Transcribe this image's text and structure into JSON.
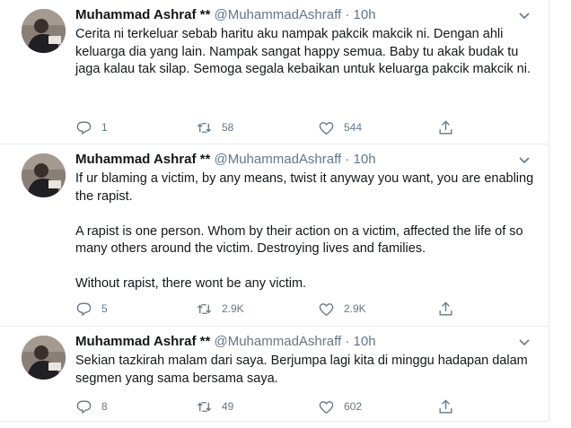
{
  "tweets": [
    {
      "name": "Muhammad Ashraf **",
      "handle": "@MuhammadAshraff",
      "separator": "·",
      "time": "10h",
      "text": "Cerita ni terkeluar sebab haritu aku nampak pakcik makcik ni. Dengan ahli keluarga dia yang lain. Nampak sangat happy semua. Baby tu akak budak tu jaga kalau tak silap. Semoga segala kebaikan untuk keluarga pakcik makcik ni.",
      "replies": "1",
      "retweets": "58",
      "likes": "544"
    },
    {
      "name": "Muhammad Ashraf **",
      "handle": "@MuhammadAshraff",
      "separator": "·",
      "time": "10h",
      "text": "If ur blaming a victim, by any means, twist it anyway you want, you are enabling the rapist.\n\nA rapist is one person. Whom by their action on a victim, affected the life of so many others around the victim. Destroying lives and families.\n\nWithout rapist, there wont be any victim.",
      "replies": "5",
      "retweets": "2.9K",
      "likes": "2.9K"
    },
    {
      "name": "Muhammad Ashraf **",
      "handle": "@MuhammadAshraff",
      "separator": "·",
      "time": "10h",
      "text": "Sekian tazkirah malam dari saya. Berjumpa lagi kita di minggu hadapan dalam segmen yang sama bersama saya.",
      "replies": "8",
      "retweets": "49",
      "likes": "602"
    }
  ],
  "colors": {
    "text": "#14171a",
    "muted": "#657786",
    "border": "#e6ecf0"
  },
  "icons": {
    "reply": "reply-icon",
    "retweet": "retweet-icon",
    "like": "like-icon",
    "share": "share-icon",
    "caret": "chevron-down-icon"
  }
}
